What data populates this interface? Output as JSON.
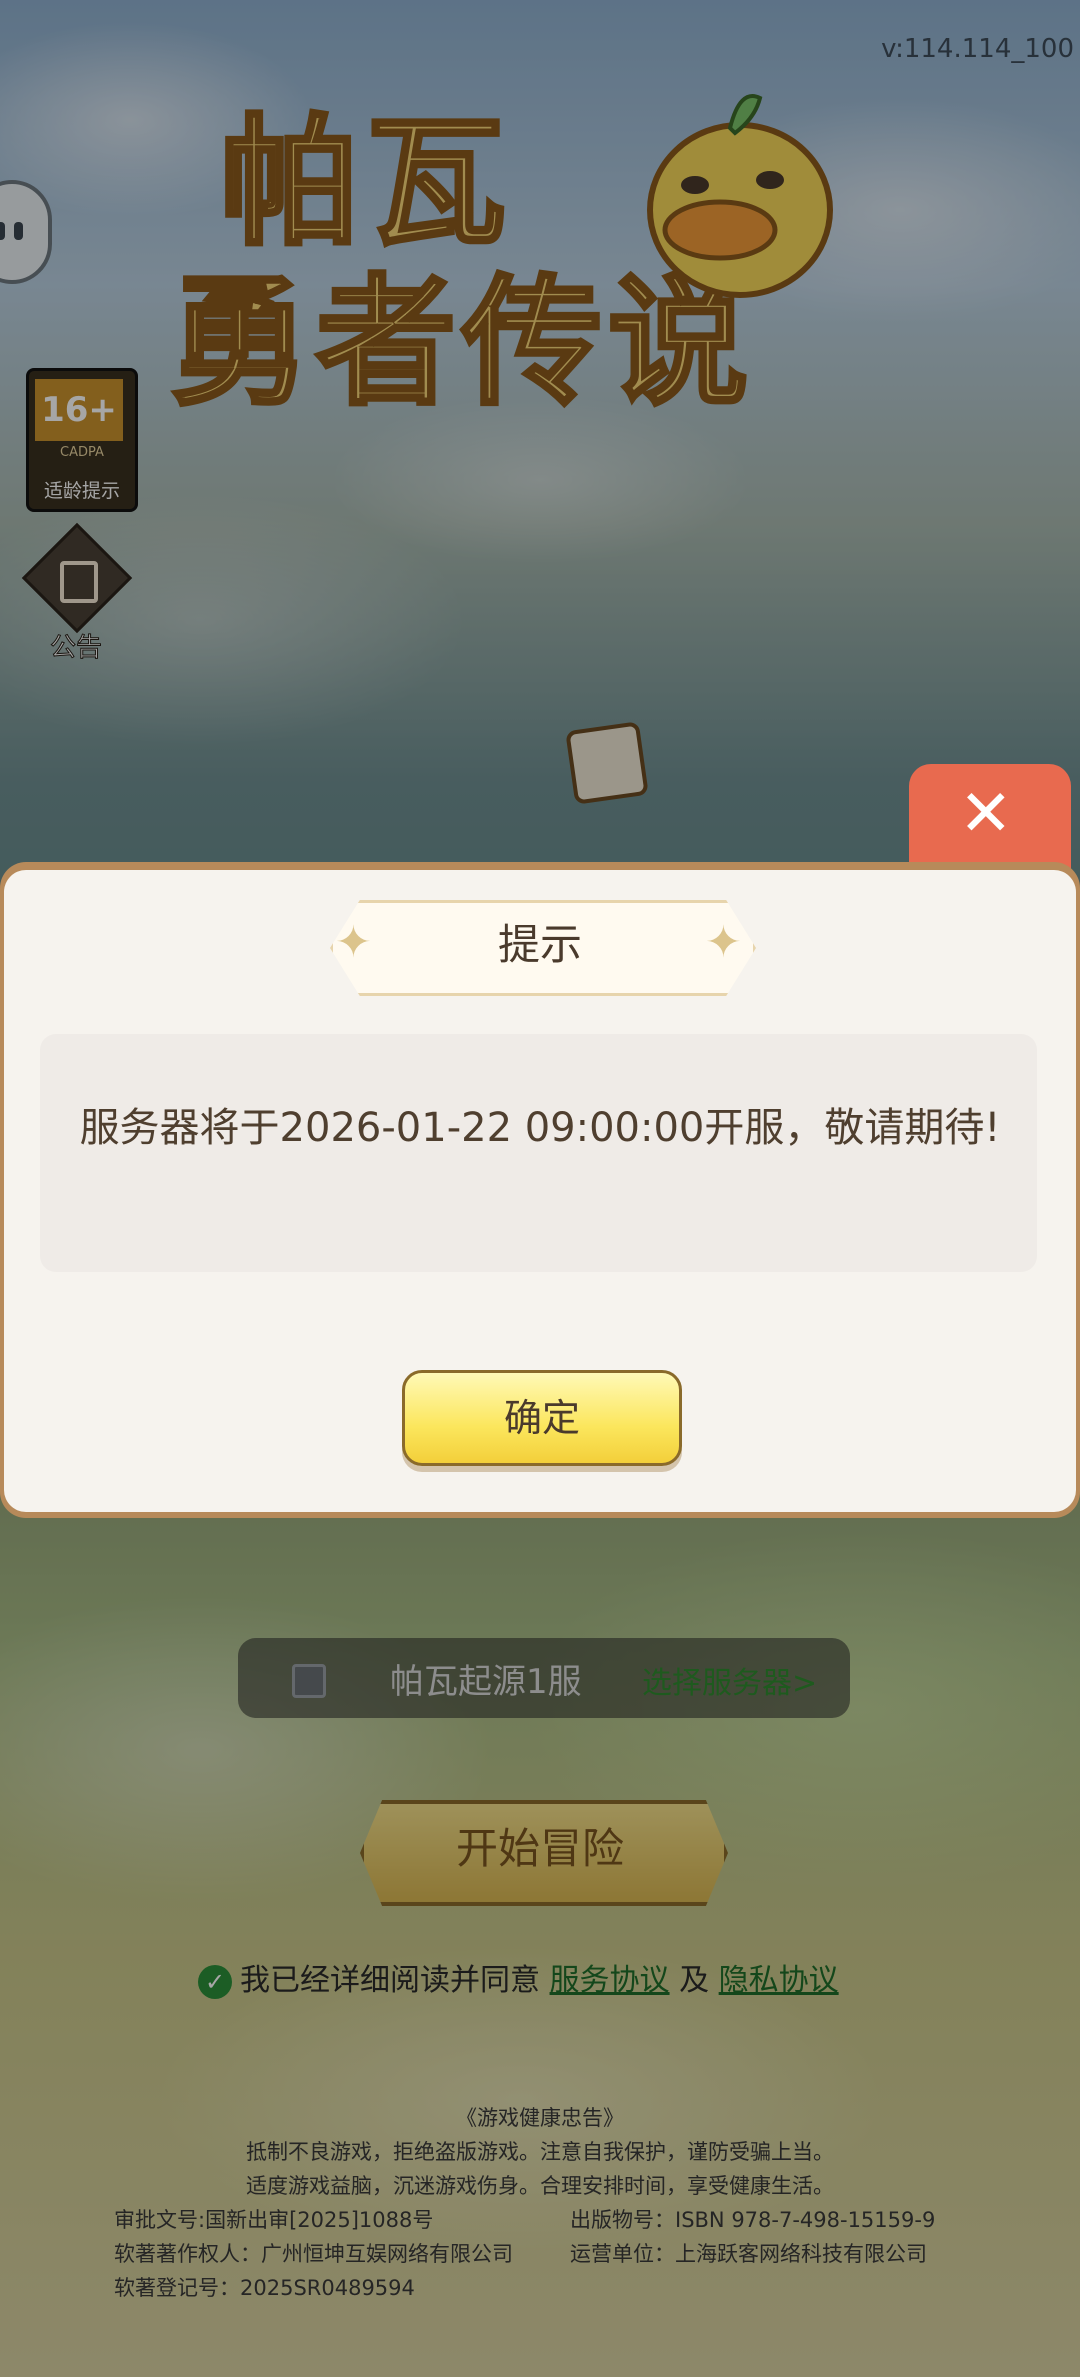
{
  "version": "v:114.114_100",
  "logo": {
    "line1": "帕瓦",
    "line2": "勇者传说"
  },
  "side": {
    "age_number": "16+",
    "age_org": "CADPA",
    "age_label": "适龄提示",
    "notice_label": "公告"
  },
  "dialog": {
    "title": "提示",
    "message": "服务器将于2026-01-22 09:00:00开服，敬请期待!",
    "ok_label": "确定",
    "close_symbol": "✕"
  },
  "server": {
    "name": "帕瓦起源1服",
    "select_label": "选择服务器>"
  },
  "start_label": "开始冒险",
  "agreement": {
    "text": "我已经详细阅读并同意",
    "service": "服务协议",
    "and": "及",
    "privacy": "隐私协议"
  },
  "legal": {
    "health_title": "《游戏健康忠告》",
    "health_line1": "抵制不良游戏，拒绝盗版游戏。注意自我保护，谨防受骗上当。",
    "health_line2": "适度游戏益脑，沉迷游戏伤身。合理安排时间，享受健康生活。",
    "approval": "审批文号:国新出审[2025]1088号",
    "isbn": "出版物号：ISBN 978-7-498-15159-9",
    "copyright_owner": "软著著作权人：广州恒坤互娱网络有限公司",
    "operator": "运营单位：上海跃客网络科技有限公司",
    "registration": "软著登记号：2025SR0489594"
  }
}
